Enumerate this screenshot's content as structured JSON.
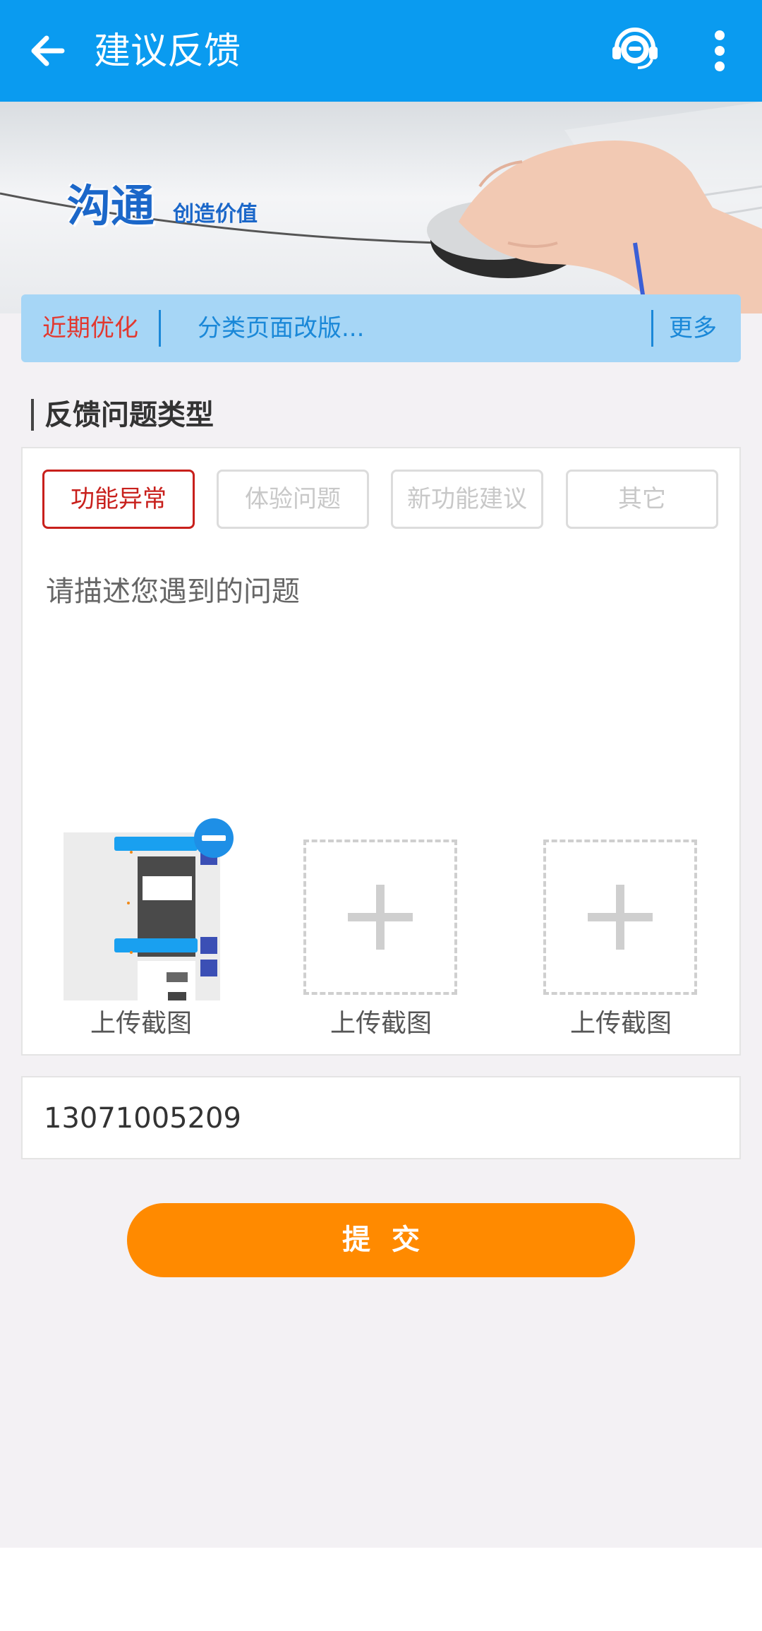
{
  "header": {
    "title": "建议反馈",
    "back_icon": "back-arrow-icon",
    "service_icon": "customer-service-icon",
    "more_icon": "more-vertical-icon",
    "bg_color": "#0a9bf0"
  },
  "banner": {
    "title": "沟通",
    "subtitle": "创造价值"
  },
  "notice": {
    "label": "近期优化",
    "text": "分类页面改版...",
    "more": "更多"
  },
  "feedback": {
    "section_title": "反馈问题类型",
    "types": [
      {
        "label": "功能异常",
        "selected": true
      },
      {
        "label": "体验问题",
        "selected": false
      },
      {
        "label": "新功能建议",
        "selected": false
      },
      {
        "label": "其它",
        "selected": false
      }
    ],
    "description_placeholder": "请描述您遇到的问题",
    "uploads": [
      {
        "label": "上传截图",
        "has_image": true
      },
      {
        "label": "上传截图",
        "has_image": false
      },
      {
        "label": "上传截图",
        "has_image": false
      }
    ]
  },
  "contact": {
    "phone": "13071005209"
  },
  "submit": {
    "label": "提交",
    "color": "#ff8a00"
  }
}
